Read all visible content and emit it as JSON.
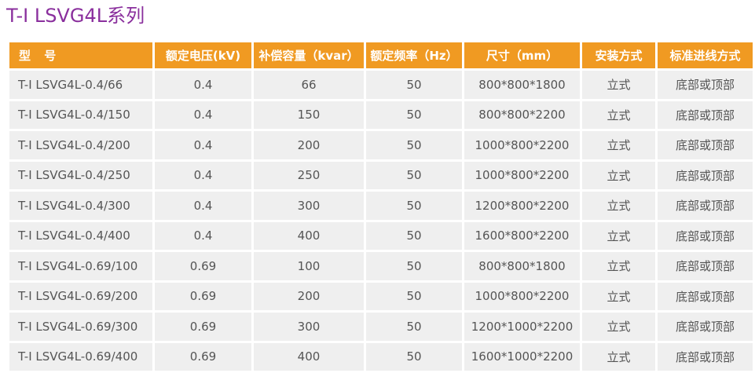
{
  "page": {
    "title": "T-I LSVG4L系列"
  },
  "table": {
    "headers": [
      "型 号",
      "额定电压(kV)",
      "补偿容量（kvar）",
      "额定频率（Hz）",
      "尺寸（mm）",
      "安装方式",
      "标准进线方式"
    ],
    "rows": [
      [
        "T-I LSVG4L-0.4/66",
        "0.4",
        "66",
        "50",
        "800*800*1800",
        "立式",
        "底部或顶部"
      ],
      [
        "T-I LSVG4L-0.4/150",
        "0.4",
        "150",
        "50",
        "800*800*2200",
        "立式",
        "底部或顶部"
      ],
      [
        "T-I LSVG4L-0.4/200",
        "0.4",
        "200",
        "50",
        "1000*800*2200",
        "立式",
        "底部或顶部"
      ],
      [
        "T-I LSVG4L-0.4/250",
        "0.4",
        "250",
        "50",
        "1000*800*2200",
        "立式",
        "底部或顶部"
      ],
      [
        "T-I LSVG4L-0.4/300",
        "0.4",
        "300",
        "50",
        "1200*800*2200",
        "立式",
        "底部或顶部"
      ],
      [
        "T-I LSVG4L-0.4/400",
        "0.4",
        "400",
        "50",
        "1600*800*2200",
        "立式",
        "底部或顶部"
      ],
      [
        "T-I LSVG4L-0.69/100",
        "0.69",
        "100",
        "50",
        "800*800*1800",
        "立式",
        "底部或顶部"
      ],
      [
        "T-I LSVG4L-0.69/200",
        "0.69",
        "200",
        "50",
        "1000*800*2200",
        "立式",
        "底部或顶部"
      ],
      [
        "T-I LSVG4L-0.69/300",
        "0.69",
        "300",
        "50",
        "1200*1000*2200",
        "立式",
        "底部或顶部"
      ],
      [
        "T-I LSVG4L-0.69/400",
        "0.69",
        "400",
        "50",
        "1600*1000*2200",
        "立式",
        "底部或顶部"
      ]
    ]
  },
  "colors": {
    "title": "#8a2f9d",
    "header_bg": "#f09a22",
    "header_text": "#ffffff",
    "cell_bg": "#efefef",
    "cell_text": "#555555"
  }
}
